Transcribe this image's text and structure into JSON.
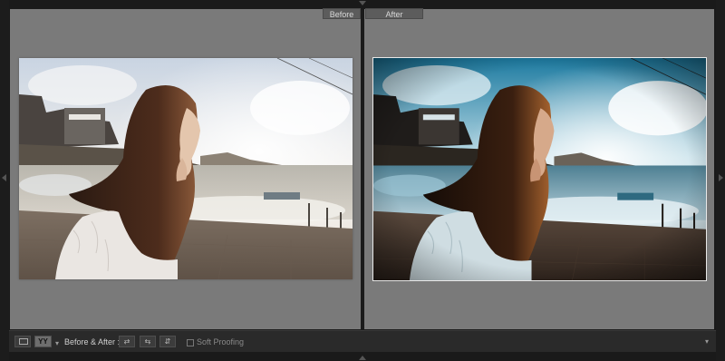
{
  "panes": {
    "before_label": "Before",
    "after_label": "After"
  },
  "toolbar": {
    "view_mode_label": "YY",
    "dropdown_glyph": "▾",
    "before_after_label": "Before & After :",
    "swap_left_glyph": "⇄",
    "swap_right_glyph": "⇆",
    "copy_glyph": "⇵",
    "soft_proofing_label": "Soft Proofing",
    "menu_glyph": "▾"
  },
  "icons": {
    "loupe": "loupe-view-icon",
    "compare": "before-after-compare-icon",
    "swap_left": "copy-before-to-after-icon",
    "swap_right": "copy-after-to-before-icon",
    "swap_both": "swap-before-after-icon"
  },
  "colors": {
    "panel_bg": "#7a7a7a",
    "toolbar_bg": "#2a2a2a",
    "frame_dark": "#1a1a1a",
    "selected_border": "#e8e8e8"
  }
}
